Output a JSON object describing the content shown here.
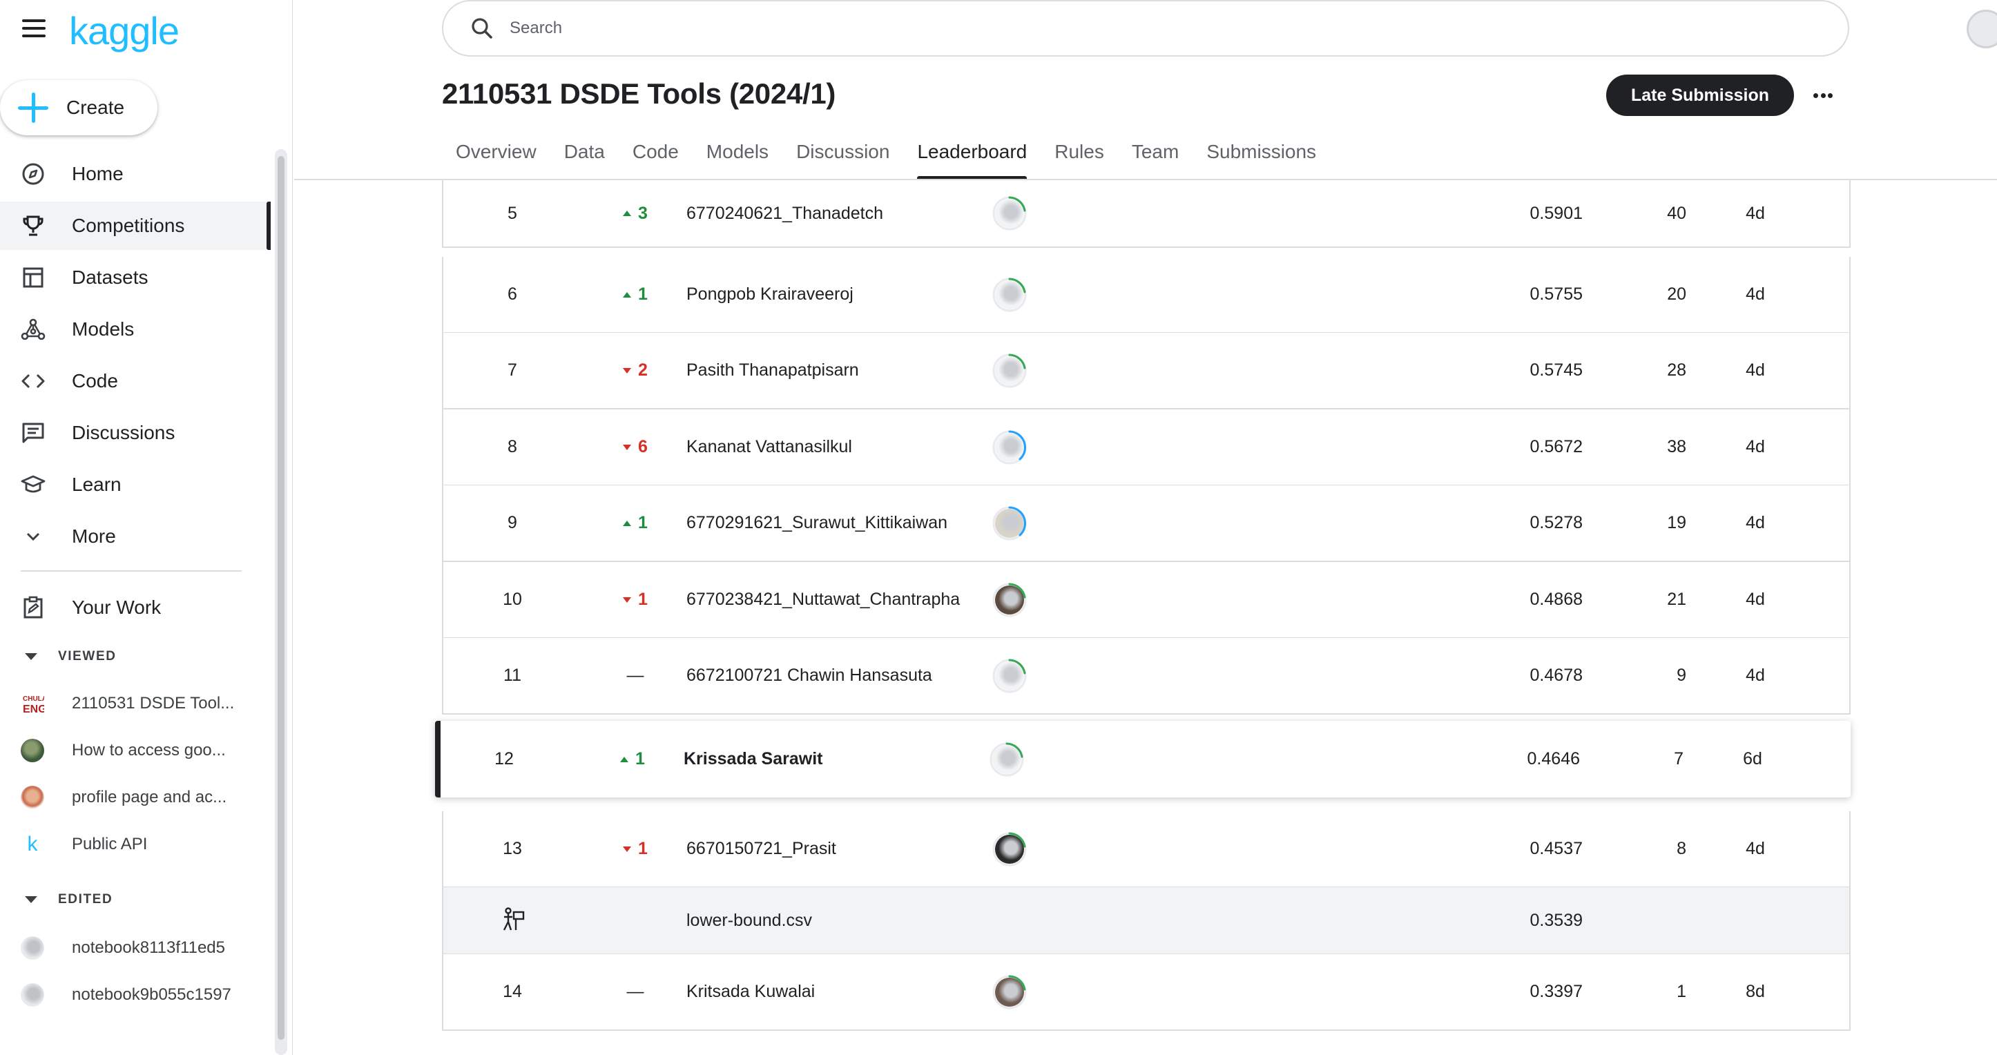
{
  "brand": {
    "logo_text": "kaggle",
    "logo_color": "#20beff"
  },
  "sidebar": {
    "create_label": "Create",
    "nav": [
      {
        "label": "Home",
        "icon": "compass-icon"
      },
      {
        "label": "Competitions",
        "icon": "trophy-icon",
        "active": true
      },
      {
        "label": "Datasets",
        "icon": "table-icon"
      },
      {
        "label": "Models",
        "icon": "models-icon"
      },
      {
        "label": "Code",
        "icon": "code-icon"
      },
      {
        "label": "Discussions",
        "icon": "discussion-icon"
      },
      {
        "label": "Learn",
        "icon": "graduation-cap-icon"
      },
      {
        "label": "More",
        "icon": "chevron-down-icon"
      }
    ],
    "your_work": "Your Work",
    "viewed_header": "VIEWED",
    "viewed": [
      {
        "label": "2110531 DSDE Tool..."
      },
      {
        "label": "How to access goo..."
      },
      {
        "label": "profile page and ac..."
      },
      {
        "label": "Public API"
      }
    ],
    "edited_header": "EDITED",
    "edited": [
      {
        "label": "notebook8113f11ed5"
      },
      {
        "label": "notebook9b055c1597"
      }
    ]
  },
  "header": {
    "search_placeholder": "Search",
    "title": "2110531 DSDE Tools (2024/1)",
    "late_submission": "Late Submission",
    "tabs": [
      "Overview",
      "Data",
      "Code",
      "Models",
      "Discussion",
      "Leaderboard",
      "Rules",
      "Team",
      "Submissions"
    ],
    "active_tab": "Leaderboard"
  },
  "leaderboard": {
    "rows": [
      {
        "rank": "5",
        "delta": "3",
        "dir": "up",
        "name": "6770240621_Thanadetch",
        "score": "0.5901",
        "entries": "40",
        "last": "4d",
        "ring": "#34a853"
      },
      {
        "rank": "6",
        "delta": "1",
        "dir": "up",
        "name": "Pongpob Krairaveeroj",
        "score": "0.5755",
        "entries": "20",
        "last": "4d",
        "ring": "#34a853"
      },
      {
        "rank": "7",
        "delta": "2",
        "dir": "down",
        "name": "Pasith Thanapatpisarn",
        "score": "0.5745",
        "entries": "28",
        "last": "4d",
        "ring": "#34a853"
      },
      {
        "rank": "8",
        "delta": "6",
        "dir": "down",
        "name": "Kananat Vattanasilkul",
        "score": "0.5672",
        "entries": "38",
        "last": "4d",
        "ring": "#20a0ff"
      },
      {
        "rank": "9",
        "delta": "1",
        "dir": "up",
        "name": "6770291621_Surawut_Kittikaiwan",
        "score": "0.5278",
        "entries": "19",
        "last": "4d",
        "ring": "#20a0ff"
      },
      {
        "rank": "10",
        "delta": "1",
        "dir": "down",
        "name": "6770238421_Nuttawat_Chantrapha",
        "score": "0.4868",
        "entries": "21",
        "last": "4d",
        "ring": "#34a853"
      },
      {
        "rank": "11",
        "delta": "—",
        "dir": "same",
        "name": "6672100721 Chawin Hansasuta",
        "score": "0.4678",
        "entries": "9",
        "last": "4d",
        "ring": "#34a853"
      },
      {
        "rank": "12",
        "delta": "1",
        "dir": "up",
        "name": "Krissada Sarawit",
        "score": "0.4646",
        "entries": "7",
        "last": "6d",
        "ring": "#34a853",
        "me": true
      },
      {
        "rank": "13",
        "delta": "1",
        "dir": "down",
        "name": "6670150721_Prasit",
        "score": "0.4537",
        "entries": "8",
        "last": "4d",
        "ring": "#34a853"
      },
      {
        "rank": "",
        "delta": "",
        "dir": "none",
        "name": "lower-bound.csv",
        "score": "0.3539",
        "entries": "",
        "last": "",
        "benchmark": true
      },
      {
        "rank": "14",
        "delta": "—",
        "dir": "same",
        "name": "Kritsada Kuwalai",
        "score": "0.3397",
        "entries": "1",
        "last": "8d",
        "ring": "#34a853"
      }
    ]
  }
}
